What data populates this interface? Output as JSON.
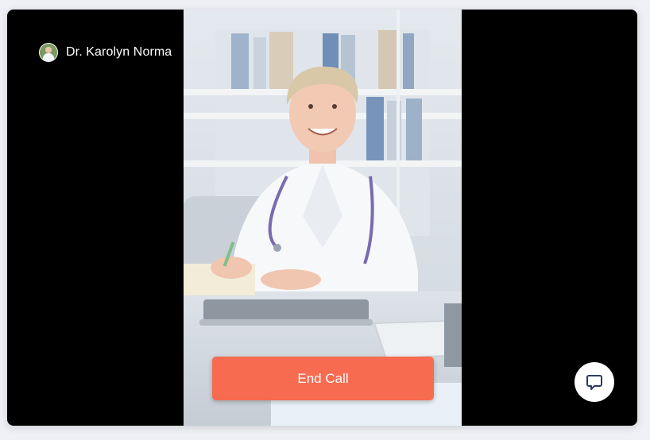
{
  "caller": {
    "name": "Dr. Karolyn Norma",
    "avatar_icon": "doctor-avatar"
  },
  "video": {
    "subject": "doctor-video-feed"
  },
  "controls": {
    "end_call_label": "End Call",
    "chat_icon": "chat-bubble-icon"
  },
  "colors": {
    "end_call": "#f76b50",
    "background": "#000000",
    "chat_icon": "#2d3a66"
  }
}
